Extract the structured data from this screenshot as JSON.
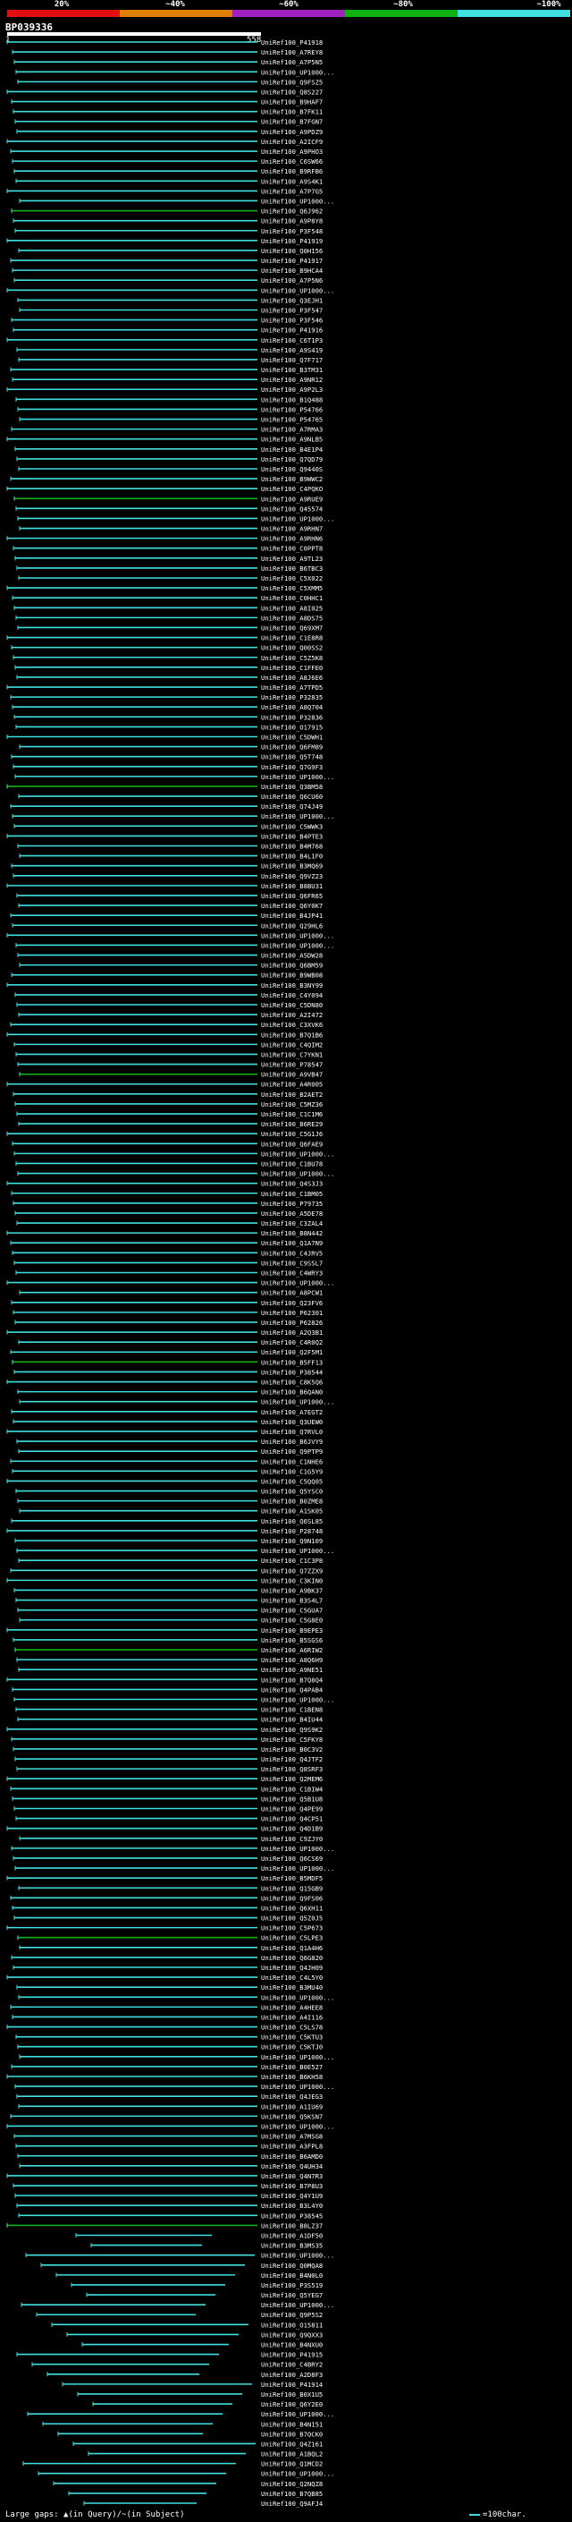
{
  "legend": {
    "labels": [
      "20%",
      "~40%",
      "~60%",
      "~80%",
      "~100%"
    ],
    "colors": [
      "#e01010",
      "#e08000",
      "#a020c0",
      "#10b010",
      "#40e0e0"
    ]
  },
  "query": {
    "id": "BP039336",
    "start": "1",
    "end": "558"
  },
  "footer": {
    "gaps_text": "Large gaps: ▲(in Query)/~(in Subject)",
    "scale_text": "=100char."
  },
  "hits": [
    "UniRef100_P41918",
    "UniRef100_A7REY8",
    "UniRef100_A7P5N5",
    "UniRef100_UP1000...",
    "UniRef100_Q9FSZ5",
    "UniRef100_Q8S227",
    "UniRef100_B9HAF7",
    "UniRef100_B7FK11",
    "UniRef100_B7FGN7",
    "UniRef100_A9PDZ9",
    "UniRef100_A2ICF9",
    "UniRef100_A9PHO3",
    "UniRef100_C6SW66",
    "UniRef100_B9RFB6",
    "UniRef100_A9S4K1",
    "UniRef100_A7P7G5",
    "UniRef100_UP1000...",
    "UniRef100_Q6J962",
    "UniRef100_A9P8Y8",
    "UniRef100_P3F548",
    "UniRef100_P41919",
    "UniRef100_Q0H156",
    "UniRef100_P41917",
    "UniRef100_B9HCA4",
    "UniRef100_A7P5N6",
    "UniRef100_UP1000...",
    "UniRef100_Q3EJH1",
    "UniRef100_P3F547",
    "UniRef100_P3F546",
    "UniRef100_P41916",
    "UniRef100_C6T1P3",
    "UniRef100_A9S419",
    "UniRef100_Q7F717",
    "UniRef100_B3TM31",
    "UniRef100_A9NR12",
    "UniRef100_A9P2L3",
    "UniRef100_B1Q488",
    "UniRef100_P54766",
    "UniRef100_P54765",
    "UniRef100_A7RMA3",
    "UniRef100_A9NLB5",
    "UniRef100_B4E1P4",
    "UniRef100_Q7QD79",
    "UniRef100_Q9440S",
    "UniRef100_B9WWC2",
    "UniRef100_C4PQKO",
    "UniRef100_A9RUE9",
    "UniRef100_Q45574",
    "UniRef100_UP1000...",
    "UniRef100_A9RHN7",
    "UniRef100_A9RHN6",
    "UniRef100_C0PPT8",
    "UniRef100_A9TL23",
    "UniRef100_B6TBC3",
    "UniRef100_C5X022",
    "UniRef100_C5XMM5",
    "UniRef100_C0HHC1",
    "UniRef100_A8I025",
    "UniRef100_A8DS75",
    "UniRef100_Q69XM7",
    "UniRef100_C1E8R8",
    "UniRef100_Q00SS2",
    "UniRef100_C5Z5K8",
    "UniRef100_C1FFE0",
    "UniRef100_A8J6E6",
    "UniRef100_A7TPD5",
    "UniRef100_P32835",
    "UniRef100_A8Q704",
    "UniRef100_P32836",
    "UniRef100_O17915",
    "UniRef100_C5DWH1",
    "UniRef100_Q6FM89",
    "UniRef100_Q5T748",
    "UniRef100_Q7G9F3",
    "UniRef100_UP1000...",
    "UniRef100_Q3BM58",
    "UniRef100_Q6CU60",
    "UniRef100_Q74J49",
    "UniRef100_UP1000...",
    "UniRef100_C5WWK3",
    "UniRef100_B4PTE3",
    "UniRef100_B4M768",
    "UniRef100_B4L1F0",
    "UniRef100_B3MQ69",
    "UniRef100_Q9VZ23",
    "UniRef100_B8BU31",
    "UniRef100_Q6FR65",
    "UniRef100_Q6Y0K7",
    "UniRef100_B4JP41",
    "UniRef100_Q29HL6",
    "UniRef100_UP1000...",
    "UniRef100_UP1000...",
    "UniRef100_A5DW28",
    "UniRef100_Q6BM59",
    "UniRef100_B9WB08",
    "UniRef100_B3NY99",
    "UniRef100_C4Y094",
    "UniRef100_C5DN80",
    "UniRef100_A2I472",
    "UniRef100_C3XVK6",
    "UniRef100_B7Q1B6",
    "UniRef100_C4QIM2",
    "UniRef100_C7YKN1",
    "UniRef100_P78547",
    "UniRef100_A9VB47",
    "UniRef100_A4R005",
    "UniRef100_B2AET2",
    "UniRef100_C5MZ36",
    "UniRef100_C1C1M6",
    "UniRef100_B6RE29",
    "UniRef100_C5G1J6",
    "UniRef100_Q6FAE9",
    "UniRef100_UP1000...",
    "UniRef100_C1BU78",
    "UniRef100_UP1000...",
    "UniRef100_Q4S3J3",
    "UniRef100_C1BM05",
    "UniRef100_P79735",
    "UniRef100_A5DE78",
    "UniRef100_C3ZAL4",
    "UniRef100_B8N442",
    "UniRef100_Q1A7N9",
    "UniRef100_C4JRV5",
    "UniRef100_C9SSL7",
    "UniRef100_C4WRY3",
    "UniRef100_UP1000...",
    "UniRef100_A8PCW1",
    "UniRef100_Q23FV6",
    "UniRef100_P62301",
    "UniRef100_P62826",
    "UniRef100_A2Q3B1",
    "UniRef100_C4R0Q2",
    "UniRef100_Q2F5M1",
    "UniRef100_B5FF13",
    "UniRef100_P38544",
    "UniRef100_C8K5Q6",
    "UniRef100_B6QAN0",
    "UniRef100_UP1000...",
    "UniRef100_A7EGT2",
    "UniRef100_Q3UEW0",
    "UniRef100_Q7RVL0",
    "UniRef100_B6JVY9",
    "UniRef100_Q9PTP9",
    "UniRef100_C1NHE6",
    "UniRef100_C1G5Y9",
    "UniRef100_C5QQ05",
    "UniRef100_Q5YSC0",
    "UniRef100_B0ZME8",
    "UniRef100_A1SK05",
    "UniRef100_Q6SL85",
    "UniRef100_P28748",
    "UniRef100_Q9N109",
    "UniRef100_UP1000...",
    "UniRef100_C1C3P8",
    "UniRef100_Q7ZZX9",
    "UniRef100_C3KIN0",
    "UniRef100_A9BK37",
    "UniRef100_B3S4L7",
    "UniRef100_C5GUA7",
    "UniRef100_C5G8E0",
    "UniRef100_B9EPE3",
    "UniRef100_B5SGS6",
    "UniRef100_A6RIW2",
    "UniRef100_A8Q6H9",
    "UniRef100_A9NE51",
    "UniRef100_B7Q8Q4",
    "UniRef100_Q4PAB4",
    "UniRef100_UP1000...",
    "UniRef100_C1BEN8",
    "UniRef100_B4IU44",
    "UniRef100_Q9S9K2",
    "UniRef100_C5FKY8",
    "UniRef100_B0C3V2",
    "UniRef100_Q4JTF2",
    "UniRef100_Q8SRF3",
    "UniRef100_Q2MEM6",
    "UniRef100_C1BIW4",
    "UniRef100_Q5B1U8",
    "UniRef100_Q4PE99",
    "UniRef100_Q4CP51",
    "UniRef100_Q4D1B9",
    "UniRef100_C9ZJY0",
    "UniRef100_UP1000...",
    "UniRef100_Q6CS69",
    "UniRef100_UP1000...",
    "UniRef100_B5MDF5",
    "UniRef100_Q15GB9",
    "UniRef100_Q9FS06",
    "UniRef100_Q6XH11",
    "UniRef100_Q5Z0J5",
    "UniRef100_C5P673",
    "UniRef100_C5LPE3",
    "UniRef100_Q1A4H6",
    "UniRef100_Q6G820",
    "UniRef100_Q4JH09",
    "UniRef100_C4L5Y0",
    "UniRef100_B3MU40",
    "UniRef100_UP1000...",
    "UniRef100_A4HEE8",
    "UniRef100_A4I116",
    "UniRef100_C5LS78",
    "UniRef100_C5KTU3",
    "UniRef100_C5KTJ0",
    "UniRef100_UP1000...",
    "UniRef100_B0E527",
    "UniRef100_B6KH58",
    "UniRef100_UP1000...",
    "UniRef100_Q4JEG3",
    "UniRef100_A1IU69",
    "UniRef100_Q5KSN7",
    "UniRef100_UP1000...",
    "UniRef100_A7MSG8",
    "UniRef100_A3FPL8",
    "UniRef100_B6AMD0",
    "UniRef100_Q4UH34",
    "UniRef100_Q4N7R3",
    "UniRef100_B7P8U3",
    "UniRef100_Q4Y1U9",
    "UniRef100_B3L4Y0",
    "UniRef100_P38545",
    "UniRef100_B8LZ37",
    "UniRef100_A1DF50",
    "UniRef100_B3MS35",
    "UniRef100_UP1000...",
    "UniRef100_Q0MQA8",
    "UniRef100_B4N0L0",
    "UniRef100_P3S519",
    "UniRef100_Q5YEG7",
    "UniRef100_UP1000...",
    "UniRef100_Q9P5S2",
    "UniRef100_O15811",
    "UniRef100_Q9QXX3",
    "UniRef100_B4NXU0",
    "UniRef100_P41915",
    "UniRef100_C4BRY2",
    "UniRef100_A2D8F3",
    "UniRef100_P41914",
    "UniRef100_B0X1U5",
    "UniRef100_Q6Y2E0",
    "UniRef100_UP1000...",
    "UniRef100_B4N151",
    "UniRef100_B7QCK0",
    "UniRef100_Q4Z161",
    "UniRef100_A1BQL2",
    "UniRef100_Q1MCD2",
    "UniRef100_UP1000...",
    "UniRef100_Q2NQZ8",
    "UniRef100_B7QB85",
    "UniRef100_Q9AFJ4"
  ]
}
